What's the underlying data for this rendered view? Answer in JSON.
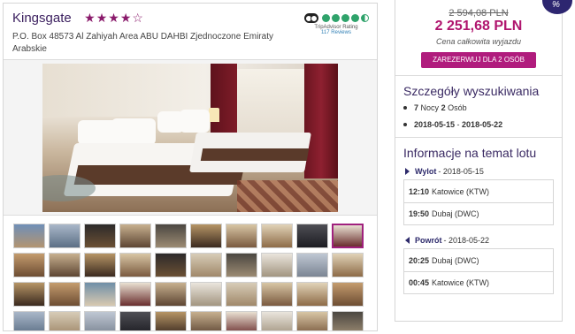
{
  "hotel": {
    "name": "Kingsgate",
    "stars_display": "★★★★☆",
    "address": "P.O. Box 48573 Al Zahiyah Area ABU DAHBI Zjednoczone Emiraty Arabskie",
    "tripadvisor": {
      "label": "TripAdvisor Rating",
      "reviews": "117 Reviews",
      "rating": 4.5
    }
  },
  "gallery": {
    "thumbnail_count": 40,
    "selected_index": 9
  },
  "pricing": {
    "old_price": "2 594,08 PLN",
    "new_price": "2 251,68 PLN",
    "note": "Cena całkowita wyjazdu",
    "book_label": "ZAREZERWUJ DLA 2 OSÓB"
  },
  "search": {
    "title": "Szczegóły wyszukiwania",
    "nights_num": "7",
    "nights_word": "Nocy",
    "persons_num": "2",
    "persons_word": "Osób",
    "date_from": "2018-05-15",
    "date_sep": " - ",
    "date_to": "2018-05-22"
  },
  "flight_info": {
    "title": "Informacje na temat lotu",
    "outbound": {
      "label": "Wylot",
      "date": " - 2018-05-15",
      "legs": [
        {
          "time": "12:10",
          "place": "Katowice (KTW)"
        },
        {
          "time": "19:50",
          "place": "Dubaj (DWC)"
        }
      ]
    },
    "return": {
      "label": "Powrót",
      "date": " - 2018-05-22",
      "legs": [
        {
          "time": "20:25",
          "place": "Dubaj (DWC)"
        },
        {
          "time": "00:45",
          "place": "Katowice (KTW)"
        }
      ]
    }
  },
  "colors": {
    "accent": "#b0156e",
    "button": "#b01c7d",
    "heading": "#3a2a63",
    "tripadvisor_green": "#2fa36b"
  },
  "badge": {
    "glyph": "%"
  }
}
